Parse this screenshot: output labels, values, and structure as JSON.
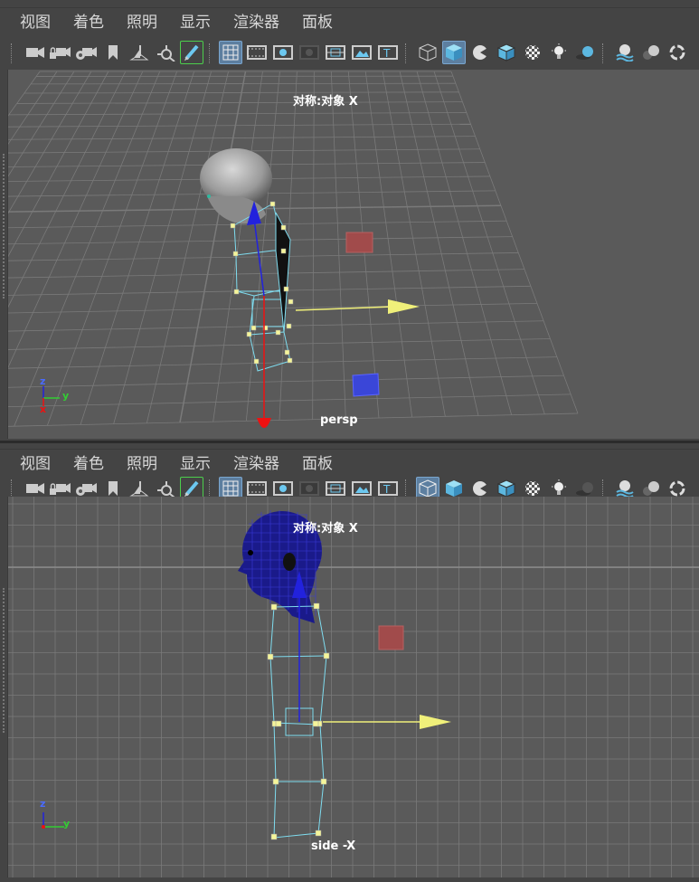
{
  "menu": [
    "视图",
    "着色",
    "照明",
    "显示",
    "渲染器",
    "面板"
  ],
  "toolbar_icons": [
    "camera-icon",
    "lock-camera-icon",
    "camera-settings-icon",
    "bookmark-icon",
    "image-plane-icon",
    "pivot-icon",
    "grease-pencil-icon",
    "grid-icon",
    "film-gate-icon",
    "resolution-gate-icon",
    "gate-mask-icon",
    "field-chart-icon",
    "safe-action-icon",
    "safe-title-icon",
    "wireframe-icon",
    "smooth-shade-icon",
    "use-default-material-icon",
    "wireframe-on-shaded-icon",
    "xray-icon",
    "lighting-icon",
    "shadows-icon",
    "screen-space-ao-icon",
    "motion-blur-icon",
    "anti-aliasing-icon"
  ],
  "viewports": {
    "top": {
      "camera_name": "persp",
      "hud_label": "对称:对象 X",
      "axis": {
        "z": "z",
        "x": "x",
        "y": "y"
      }
    },
    "bottom": {
      "camera_name": "side -X",
      "hud_label": "对称:对象 X",
      "axis": {
        "z": "z",
        "y": "y"
      }
    }
  },
  "colors": {
    "panel_bg": "#444444",
    "viewport_bg": "#5a5a5a",
    "grid": "#7a7a7a",
    "selection_wire": "#7fdcef",
    "vertex": "#f5f59a",
    "active_toggle": "#5d7fa0",
    "manipulator_x": "#f0f07a",
    "manipulator_y": "#2222dd",
    "manipulator_z": "#ee1111"
  }
}
